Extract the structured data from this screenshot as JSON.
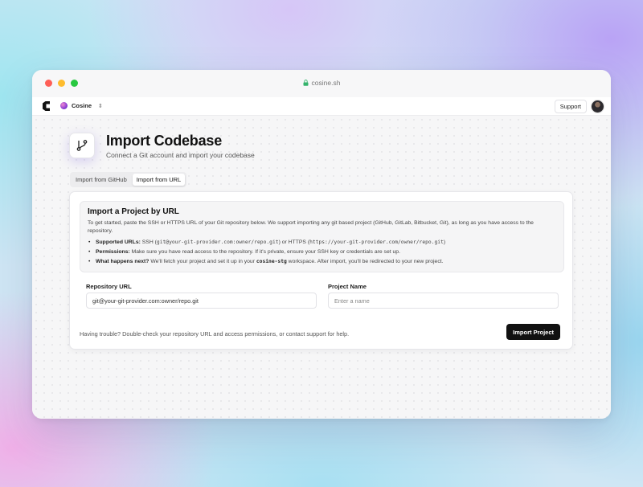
{
  "browser": {
    "url": "cosine.sh"
  },
  "appbar": {
    "workspace_name": "Cosine",
    "support_label": "Support"
  },
  "header": {
    "title": "Import Codebase",
    "subtitle": "Connect a Git account and import your codebase"
  },
  "tabs": [
    {
      "label": "Import from GitHub",
      "active": false
    },
    {
      "label": "Import from URL",
      "active": true
    }
  ],
  "info": {
    "title": "Import a Project by URL",
    "intro": "To get started, paste the SSH or HTTPS URL of your Git repository below. We support importing any git based project (GitHub, GitLab, Bitbucket, Git), as long as you have access to the repository.",
    "bullets": {
      "supported": {
        "label": "Supported URLs:",
        "text_1": " SSH (",
        "ssh_example": "git@your-git-provider.com:owner/repo.git",
        "text_2": ") or HTTPS (",
        "https_example": "https://your-git-provider.com/owner/repo.git",
        "text_3": ")"
      },
      "permissions": {
        "label": "Permissions:",
        "text": " Make sure you have read access to the repository. If it's private, ensure your SSH key or credentials are set up."
      },
      "next": {
        "label": "What happens next?",
        "text_1": " We'll fetch your project and set it up in your ",
        "workspace": "cosine-stg",
        "text_2": " workspace. After import, you'll be redirected to your new project."
      }
    }
  },
  "form": {
    "repo_label": "Repository URL",
    "repo_value": "git@your-git-provider.com:owner/repo.git",
    "name_label": "Project Name",
    "name_placeholder": "Enter a name"
  },
  "footer": {
    "help_text": "Having trouble? Double-check your repository URL and access permissions, or contact support for help.",
    "import_label": "Import Project"
  },
  "icons": {
    "lock": "lock-icon",
    "logo": "cosine-logo-icon",
    "workspace_chevron": "chevron-updown-icon",
    "header": "git-branch-icon"
  },
  "colors": {
    "primary_button": "#111111",
    "traffic_red": "#fe5f57",
    "traffic_yellow": "#febc2e",
    "traffic_green": "#28c840"
  }
}
